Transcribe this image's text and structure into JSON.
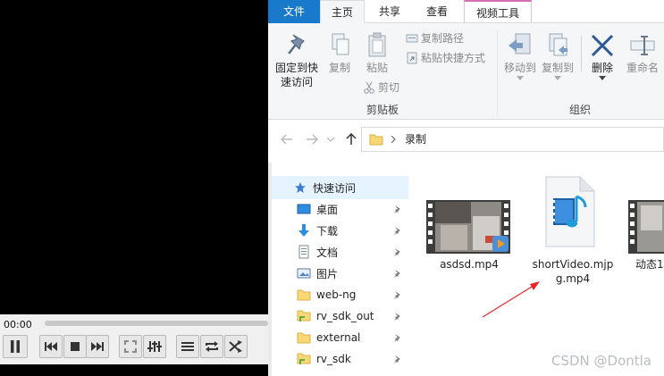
{
  "player": {
    "time": "00:00"
  },
  "ribbon": {
    "tabs": [
      {
        "label": "文件"
      },
      {
        "label": "主页"
      },
      {
        "label": "共享"
      },
      {
        "label": "查看"
      },
      {
        "label": "视频工具"
      }
    ],
    "clipboard": {
      "pin_label_1": "固定到快",
      "pin_label_2": "速访问",
      "copy": "复制",
      "paste": "粘贴",
      "copy_path": "复制路径",
      "paste_shortcut": "粘贴快捷方式",
      "cut": "剪切",
      "group": "剪贴板"
    },
    "organize": {
      "move_to": "移动到",
      "copy_to": "复制到",
      "delete": "删除",
      "rename": "重命名",
      "group": "组织"
    }
  },
  "address": {
    "path": "录制"
  },
  "nav": {
    "items": [
      {
        "label": "快速访问"
      },
      {
        "label": "桌面"
      },
      {
        "label": "下载"
      },
      {
        "label": "文档"
      },
      {
        "label": "图片"
      },
      {
        "label": "web-ng"
      },
      {
        "label": "rv_sdk_out"
      },
      {
        "label": "external"
      },
      {
        "label": "rv_sdk"
      }
    ]
  },
  "files": [
    {
      "name": "asdsd.mp4"
    },
    {
      "name_line1": "shortVideo.mjp",
      "name_line2": "g.mp4"
    },
    {
      "name": "动态1"
    }
  ],
  "watermark": "CSDN @Dontla",
  "colors": {
    "file_tab": "#1979ca",
    "video_tools_accent": "#d36fb2",
    "selection": "#e5f3ff",
    "folder": "#f8d775",
    "delete_icon": "#2b5797",
    "arrow": "#e8262a"
  }
}
